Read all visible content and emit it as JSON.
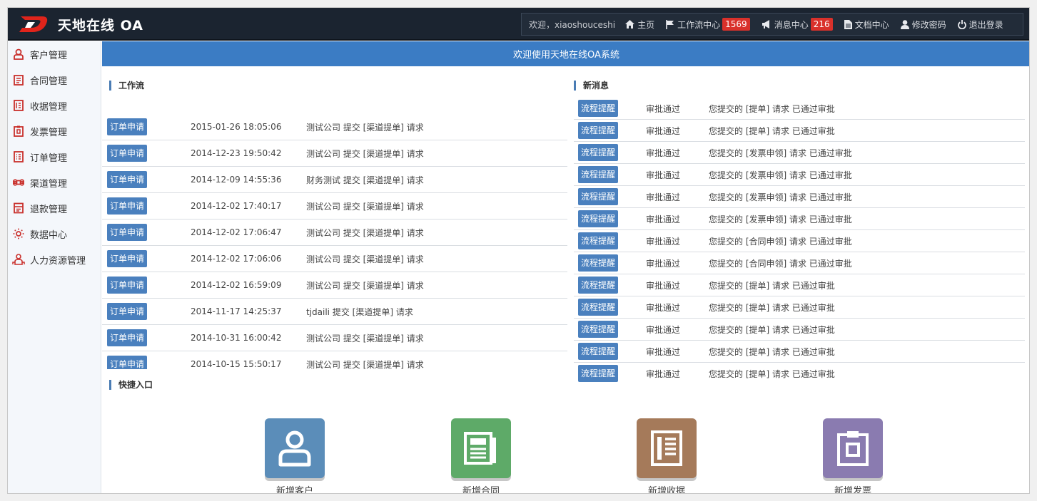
{
  "app": {
    "title": "天地在线 OA"
  },
  "nav": {
    "welcome": "欢迎，xiaoshouceshi",
    "items": [
      {
        "label": "主页",
        "icon": "home-icon"
      },
      {
        "label": "工作流中心",
        "icon": "flag-icon",
        "badge": "1569"
      },
      {
        "label": "消息中心",
        "icon": "megaphone-icon",
        "badge": "216"
      },
      {
        "label": "文档中心",
        "icon": "document-icon"
      },
      {
        "label": "修改密码",
        "icon": "user-icon"
      },
      {
        "label": "退出登录",
        "icon": "power-icon"
      }
    ]
  },
  "sidebar": {
    "items": [
      {
        "label": "客户管理",
        "icon": "customer-icon"
      },
      {
        "label": "合同管理",
        "icon": "contract-icon"
      },
      {
        "label": "收据管理",
        "icon": "receipt-icon"
      },
      {
        "label": "发票管理",
        "icon": "invoice-icon"
      },
      {
        "label": "订单管理",
        "icon": "order-icon"
      },
      {
        "label": "渠道管理",
        "icon": "command-icon"
      },
      {
        "label": "退款管理",
        "icon": "refund-icon"
      },
      {
        "label": "数据中心",
        "icon": "sun-icon"
      },
      {
        "label": "人力资源管理",
        "icon": "hr-icon"
      }
    ]
  },
  "main": {
    "welcome_banner": "欢迎使用天地在线OA系统",
    "workflow": {
      "title": "工作流",
      "rows": [
        {
          "tag": "订单申请",
          "time": "2015-01-26 18:05:06",
          "desc": "测试公司 提交 [渠道提单] 请求"
        },
        {
          "tag": "订单申请",
          "time": "2014-12-23 19:50:42",
          "desc": "测试公司 提交 [渠道提单] 请求"
        },
        {
          "tag": "订单申请",
          "time": "2014-12-09 14:55:36",
          "desc": "财务测试 提交 [渠道提单] 请求"
        },
        {
          "tag": "订单申请",
          "time": "2014-12-02 17:40:17",
          "desc": "测试公司 提交 [渠道提单] 请求"
        },
        {
          "tag": "订单申请",
          "time": "2014-12-02 17:06:47",
          "desc": "测试公司 提交 [渠道提单] 请求"
        },
        {
          "tag": "订单申请",
          "time": "2014-12-02 17:06:06",
          "desc": "测试公司 提交 [渠道提单] 请求"
        },
        {
          "tag": "订单申请",
          "time": "2014-12-02 16:59:09",
          "desc": "测试公司 提交 [渠道提单] 请求"
        },
        {
          "tag": "订单申请",
          "time": "2014-11-17 14:25:37",
          "desc": "tjdaili 提交 [渠道提单] 请求"
        },
        {
          "tag": "订单申请",
          "time": "2014-10-31 16:00:42",
          "desc": "测试公司 提交 [渠道提单] 请求"
        },
        {
          "tag": "订单申请",
          "time": "2014-10-15 15:50:17",
          "desc": "测试公司 提交 [渠道提单] 请求"
        }
      ]
    },
    "messages": {
      "title": "新消息",
      "rows": [
        {
          "tag": "流程提醒",
          "status": "审批通过",
          "desc": "您提交的 [提单] 请求 已通过审批"
        },
        {
          "tag": "流程提醒",
          "status": "审批通过",
          "desc": "您提交的 [提单] 请求 已通过审批"
        },
        {
          "tag": "流程提醒",
          "status": "审批通过",
          "desc": "您提交的 [发票申领] 请求 已通过审批"
        },
        {
          "tag": "流程提醒",
          "status": "审批通过",
          "desc": "您提交的 [发票申领] 请求 已通过审批"
        },
        {
          "tag": "流程提醒",
          "status": "审批通过",
          "desc": "您提交的 [发票申领] 请求 已通过审批"
        },
        {
          "tag": "流程提醒",
          "status": "审批通过",
          "desc": "您提交的 [发票申领] 请求 已通过审批"
        },
        {
          "tag": "流程提醒",
          "status": "审批通过",
          "desc": "您提交的 [合同申领] 请求 已通过审批"
        },
        {
          "tag": "流程提醒",
          "status": "审批通过",
          "desc": "您提交的 [合同申领] 请求 已通过审批"
        },
        {
          "tag": "流程提醒",
          "status": "审批通过",
          "desc": "您提交的 [提单] 请求 已通过审批"
        },
        {
          "tag": "流程提醒",
          "status": "审批通过",
          "desc": "您提交的 [提单] 请求 已通过审批"
        },
        {
          "tag": "流程提醒",
          "status": "审批通过",
          "desc": "您提交的 [提单] 请求 已通过审批"
        },
        {
          "tag": "流程提醒",
          "status": "审批通过",
          "desc": "您提交的 [提单] 请求 已通过审批"
        },
        {
          "tag": "流程提醒",
          "status": "审批通过",
          "desc": "您提交的 [提单] 请求 已通过审批"
        }
      ]
    },
    "quick": {
      "title": "快捷入口",
      "items": [
        {
          "label": "新增客户",
          "icon": "add-customer-icon",
          "color": "#5b8db9"
        },
        {
          "label": "新增合同",
          "icon": "add-contract-icon",
          "color": "#5eaa68"
        },
        {
          "label": "新增收据",
          "icon": "add-receipt-icon",
          "color": "#a57a5a"
        },
        {
          "label": "新增发票",
          "icon": "add-invoice-icon",
          "color": "#8a7bb0"
        }
      ]
    }
  },
  "colors": {
    "topbar": "#1b2430",
    "banner": "#3b7cc4",
    "tag": "#4a80be",
    "badge": "#d9312b",
    "sidebar_icon": "#c9302c"
  }
}
